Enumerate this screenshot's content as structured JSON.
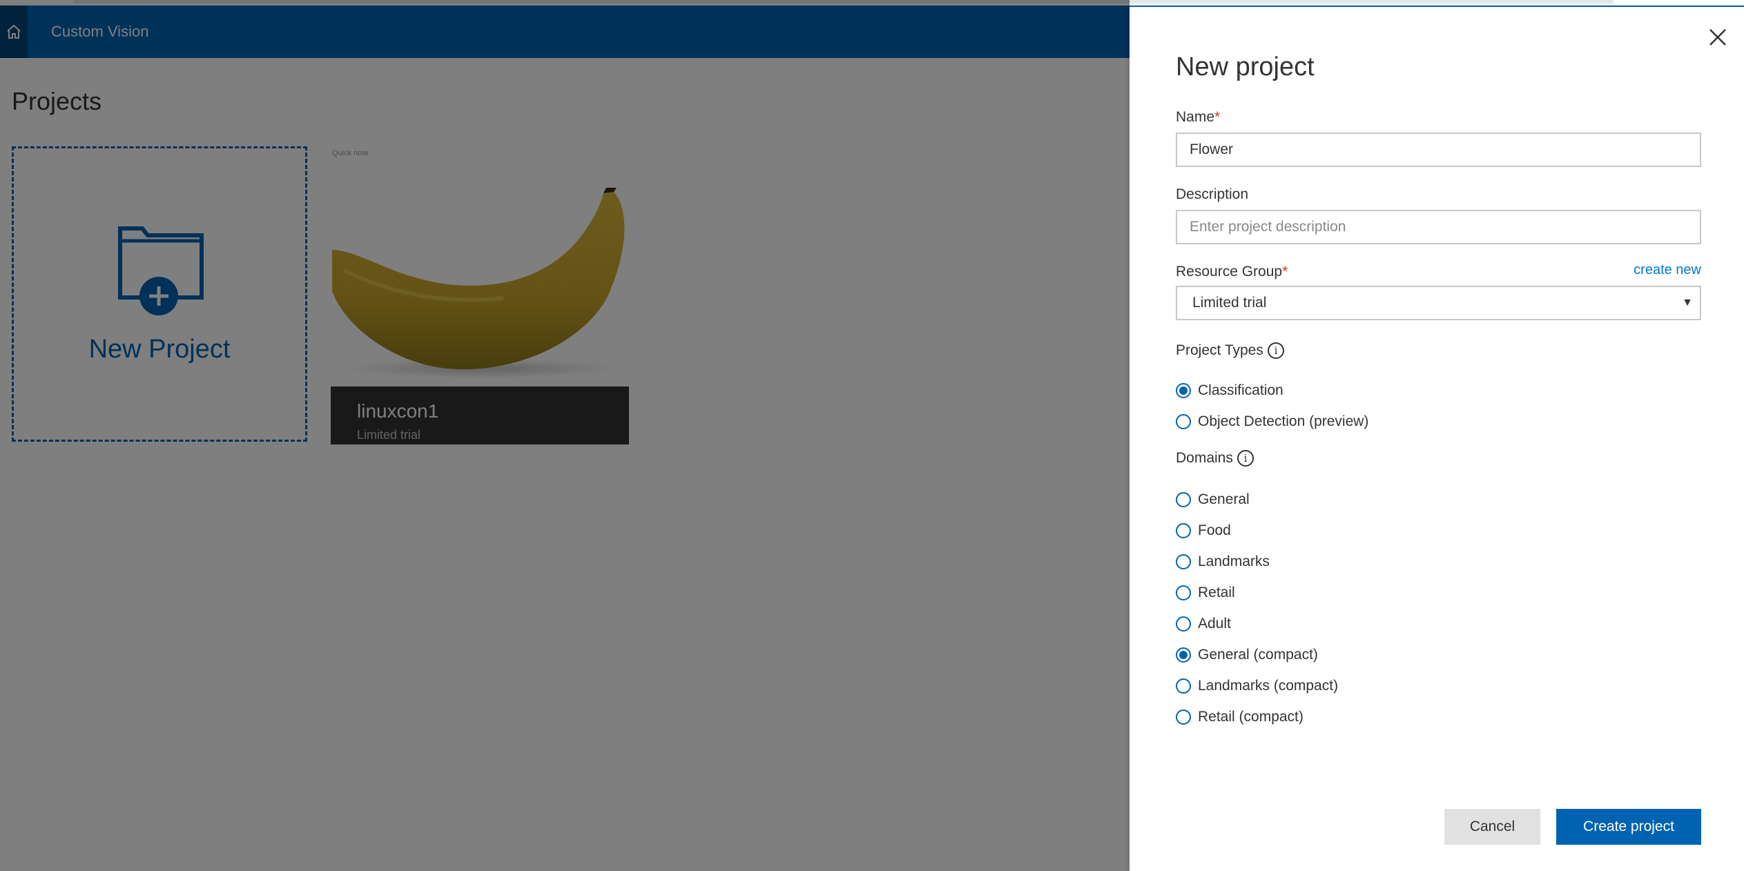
{
  "app": {
    "title": "Custom Vision"
  },
  "projects_page": {
    "title": "Projects",
    "new_project_label": "New Project",
    "cards": [
      {
        "name": "linuxcon1",
        "resource": "Limited trial",
        "thumb_caption": "Quick note"
      }
    ]
  },
  "panel": {
    "title": "New project",
    "name_label": "Name",
    "name_value": "Flower",
    "description_label": "Description",
    "description_placeholder": "Enter project description",
    "resource_group_label": "Resource Group",
    "required_mark": "*",
    "create_new_link": "create new",
    "resource_group_value": "Limited trial",
    "project_types_label": "Project Types",
    "project_types": [
      {
        "label": "Classification",
        "checked": true
      },
      {
        "label": "Object Detection (preview)",
        "checked": false
      }
    ],
    "domains_label": "Domains",
    "domains": [
      {
        "label": "General",
        "checked": false
      },
      {
        "label": "Food",
        "checked": false
      },
      {
        "label": "Landmarks",
        "checked": false
      },
      {
        "label": "Retail",
        "checked": false
      },
      {
        "label": "Adult",
        "checked": false
      },
      {
        "label": "General (compact)",
        "checked": true
      },
      {
        "label": "Landmarks (compact)",
        "checked": false
      },
      {
        "label": "Retail (compact)",
        "checked": false
      }
    ],
    "cancel_label": "Cancel",
    "create_label": "Create project"
  },
  "colors": {
    "header": "#0065b3",
    "accent": "#0063b1",
    "link": "#0078d4",
    "overlay": "rgba(0,0,0,0.5)"
  },
  "icons": [
    "home-icon",
    "new-folder-icon",
    "close-icon",
    "info-icon",
    "dropdown-arrow-icon"
  ]
}
